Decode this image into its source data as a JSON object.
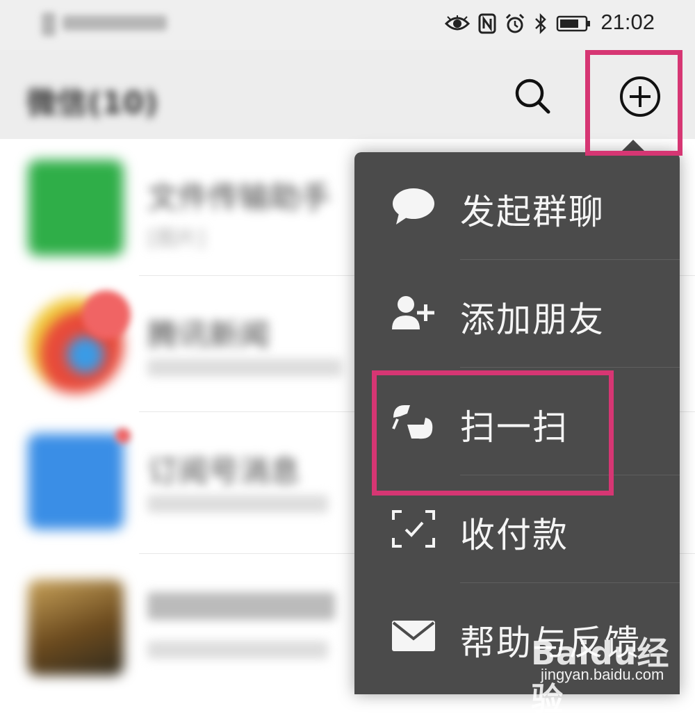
{
  "status_bar": {
    "time": "21:02",
    "icons": [
      "eye-icon",
      "nfc-icon",
      "alarm-icon",
      "bluetooth-icon",
      "battery-icon"
    ]
  },
  "header": {
    "title": "微信(10)",
    "search_icon": "search-icon",
    "add_icon": "plus-circle-icon"
  },
  "chat_list": [
    {
      "name": "文件传输助手",
      "preview": "[图片]",
      "avatar_color": "#2fae48"
    },
    {
      "name": "腾讯新闻",
      "preview": "",
      "avatar_color": "#e8c23a"
    },
    {
      "name": "订阅号消息",
      "preview": "",
      "avatar_color": "#3a8ee6"
    },
    {
      "name": "",
      "preview": "",
      "avatar_color": "#7a5a2a"
    }
  ],
  "popup_menu": {
    "items": [
      {
        "label": "发起群聊",
        "icon": "chat-bubble-icon"
      },
      {
        "label": "添加朋友",
        "icon": "add-user-icon"
      },
      {
        "label": "扫一扫",
        "icon": "scan-icon"
      },
      {
        "label": "收付款",
        "icon": "payment-scan-icon"
      },
      {
        "label": "帮助与反馈",
        "icon": "envelope-icon"
      }
    ]
  },
  "highlight_color": "#d63673",
  "watermark": {
    "brand": "Baidu经验",
    "url": "jingyan.baidu.com"
  }
}
